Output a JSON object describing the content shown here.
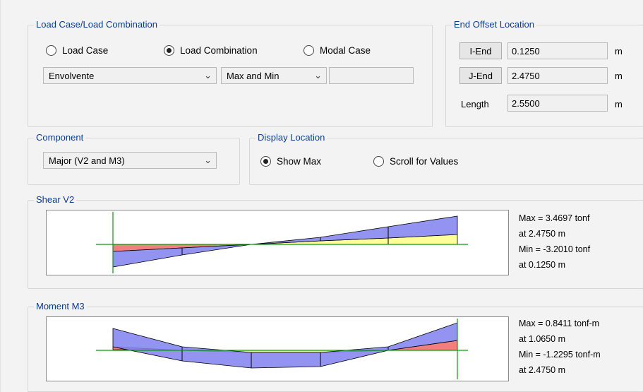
{
  "load_group": {
    "title": "Load Case/Load Combination",
    "radios": [
      {
        "label": "Load Case",
        "selected": false
      },
      {
        "label": "Load Combination",
        "selected": true
      },
      {
        "label": "Modal Case",
        "selected": false
      }
    ],
    "combo_name": "Envolvente",
    "combo_mode": "Max and Min",
    "extra_field": ""
  },
  "end_offset": {
    "title": "End Offset Location",
    "rows": [
      {
        "label": "I-End",
        "value": "0.1250",
        "unit": "m"
      },
      {
        "label": "J-End",
        "value": "2.4750",
        "unit": "m"
      },
      {
        "label": "Length",
        "value": "2.5500",
        "unit": "m"
      }
    ]
  },
  "component": {
    "title": "Component",
    "value": "Major (V2 and M3)"
  },
  "display_location": {
    "title": "Display Location",
    "radios": [
      {
        "label": "Show Max",
        "selected": true
      },
      {
        "label": "Scroll for Values",
        "selected": false
      }
    ]
  },
  "shear": {
    "title": "Shear V2",
    "max_line": "Max = 3.4697 tonf",
    "max_at": "at 2.4750 m",
    "min_line": "Min = -3.2010 tonf",
    "min_at": "at 0.1250 m"
  },
  "moment": {
    "title": "Moment M3",
    "max_line": "Max = 0.8411 tonf-m",
    "max_at": "at 1.0650 m",
    "min_line": "Min = -1.2295 tonf-m",
    "min_at": "at 2.4750 m"
  },
  "colors": {
    "envelope_blue": "#8080f0",
    "positive_yellow": "#ffff99",
    "negative_red": "#f08080",
    "axis_green": "#00a000",
    "group_title": "#0a3c8c"
  },
  "icons": {
    "dropdown": "chevron-down-icon",
    "radio": "radio-button-icon"
  }
}
